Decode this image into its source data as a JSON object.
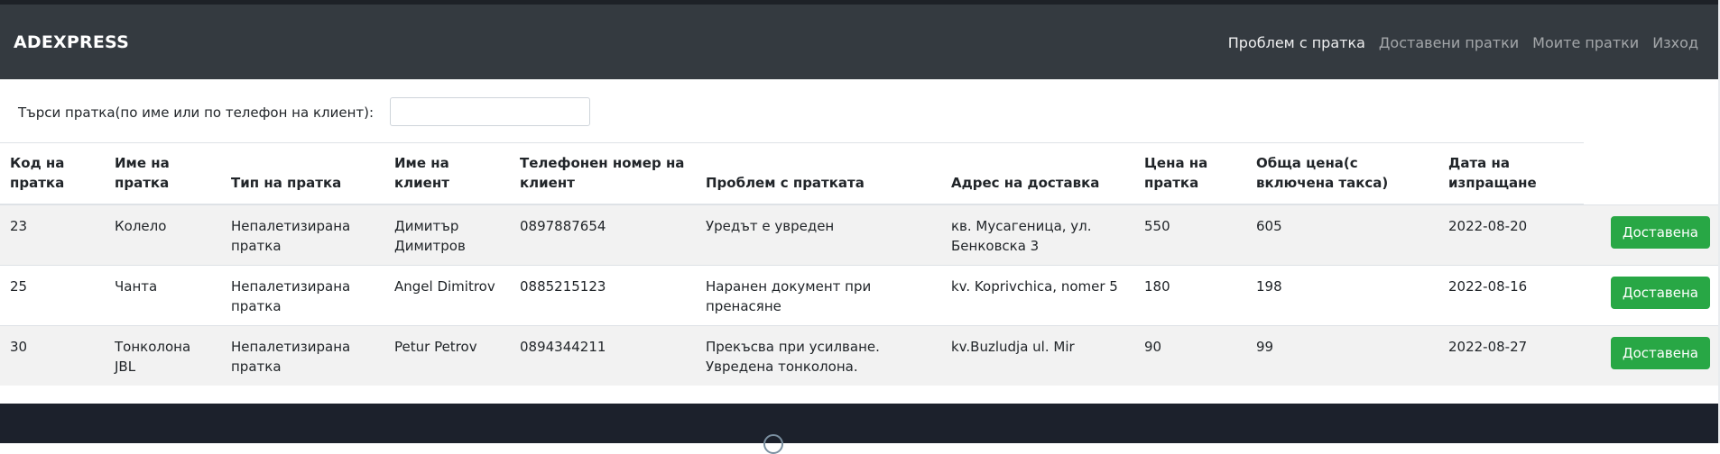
{
  "navbar": {
    "brand": "ADEXPRESS",
    "links": [
      {
        "label": "Проблем с пратка",
        "active": true
      },
      {
        "label": "Доставени пратки",
        "active": false
      },
      {
        "label": "Моите пратки",
        "active": false
      },
      {
        "label": "Изход",
        "active": false
      }
    ]
  },
  "search": {
    "label": "Търси пратка(по име или по телефон на клиент):",
    "value": "",
    "placeholder": ""
  },
  "table": {
    "headers": [
      "Код на пратка",
      "Име на пратка",
      "Тип на пратка",
      "Име на клиент",
      "Телефонен номер на клиент",
      "Проблем с пратката",
      "Адрес на доставка",
      "Цена на пратка",
      "Обща цена(с включена такса)",
      "Дата на изпращане"
    ],
    "header_lines": [
      [
        "Код на",
        "пратка"
      ],
      [
        "Име на",
        "пратка"
      ],
      [
        "Тип на пратка"
      ],
      [
        "Име на",
        "клиент"
      ],
      [
        "Телефонен номер на",
        "клиент"
      ],
      [
        "Проблем с пратката"
      ],
      [
        "Адрес на доставка"
      ],
      [
        "Цена на",
        "пратка"
      ],
      [
        "Обща цена(с",
        "включена такса)"
      ],
      [
        "Дата на",
        "изпращане"
      ]
    ],
    "rows": [
      {
        "code": "23",
        "name": "Колело",
        "type": "Непалетизирана пратка",
        "client": "Димитър Димитров",
        "phone": "0897887654",
        "problem": "Уредът е увреден",
        "address": "кв. Мусагеница, ул. Бенковска 3",
        "price": "550",
        "total": "605",
        "date": "2022-08-20",
        "action": "Доставена"
      },
      {
        "code": "25",
        "name": "Чанта",
        "type": "Непалетизирана пратка",
        "client": "Angel Dimitrov",
        "phone": "0885215123",
        "problem": "Наранен документ при пренасяне",
        "address": "kv. Koprivchica, nomer 5",
        "price": "180",
        "total": "198",
        "date": "2022-08-16",
        "action": "Доставена"
      },
      {
        "code": "30",
        "name": "Тонколона JBL",
        "type": "Непалетизирана пратка",
        "client": "Petur Petrov",
        "phone": "0894344211",
        "problem": "Прекъсва при усилване. Увредена тонколона.",
        "address": "kv.Buzludja ul. Mir",
        "price": "90",
        "total": "99",
        "date": "2022-08-27",
        "action": "Доставена"
      }
    ]
  },
  "footer": {
    "text": "",
    "icon": "globe-icon"
  },
  "colors": {
    "navbar_bg": "#343a40",
    "success": "#28a745",
    "footer_bg": "#1c212c"
  }
}
